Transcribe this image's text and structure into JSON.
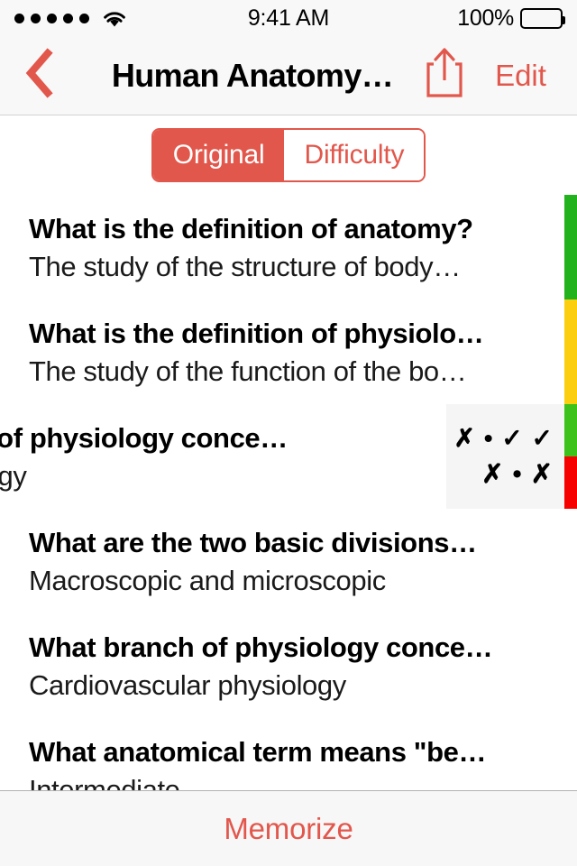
{
  "status_bar": {
    "signal_dots": 5,
    "wifi": "wifi-icon",
    "time": "9:41 AM",
    "battery_percent": "100%"
  },
  "nav": {
    "back_icon": "chevron-left-icon",
    "title": "Human Anatomy…",
    "share_icon": "share-icon",
    "edit_label": "Edit"
  },
  "segmented": {
    "options": [
      {
        "label": "Original",
        "selected": true
      },
      {
        "label": "Difficulty",
        "selected": false
      }
    ]
  },
  "colors": {
    "accent_red": "#e2574c",
    "indicator_green": "#22b21e",
    "indicator_bright_green": "#3cc21a",
    "indicator_yellow": "#fcce10",
    "indicator_red": "#f60000",
    "nav_background": "#f8f8f8",
    "panel_background": "#f5f5f5",
    "toolbar_background": "#f7f7f7"
  },
  "list": {
    "rows": [
      {
        "question": "What is the definition of anatomy?",
        "answer": "The study of the structure of body…",
        "markers": [
          {
            "color": "#22b21e",
            "fraction": 1
          }
        ],
        "swiped": false
      },
      {
        "question": "What is the definition of physiolo…",
        "answer": "The study of the function of the bo…",
        "markers": [
          {
            "color": "#fcce10",
            "fraction": 1
          }
        ],
        "swiped": false
      },
      {
        "question": "branch of physiology conce…",
        "answer": "physiology",
        "markers": [
          {
            "color": "#3cc21a",
            "fraction": 0.5
          },
          {
            "color": "#f60000",
            "fraction": 0.5
          }
        ],
        "swiped": true,
        "history": [
          "✗ • ✓ ✓",
          "✗ • ✗"
        ]
      },
      {
        "question": "What are the two basic divisions…",
        "answer": "Macroscopic and microscopic",
        "markers": [],
        "swiped": false
      },
      {
        "question": "What branch of physiology conce…",
        "answer": "Cardiovascular physiology",
        "markers": [],
        "swiped": false
      },
      {
        "question": "What anatomical term means \"be…",
        "answer": "Intermediate",
        "markers": [],
        "swiped": false
      }
    ]
  },
  "toolbar": {
    "memorize_label": "Memorize"
  }
}
